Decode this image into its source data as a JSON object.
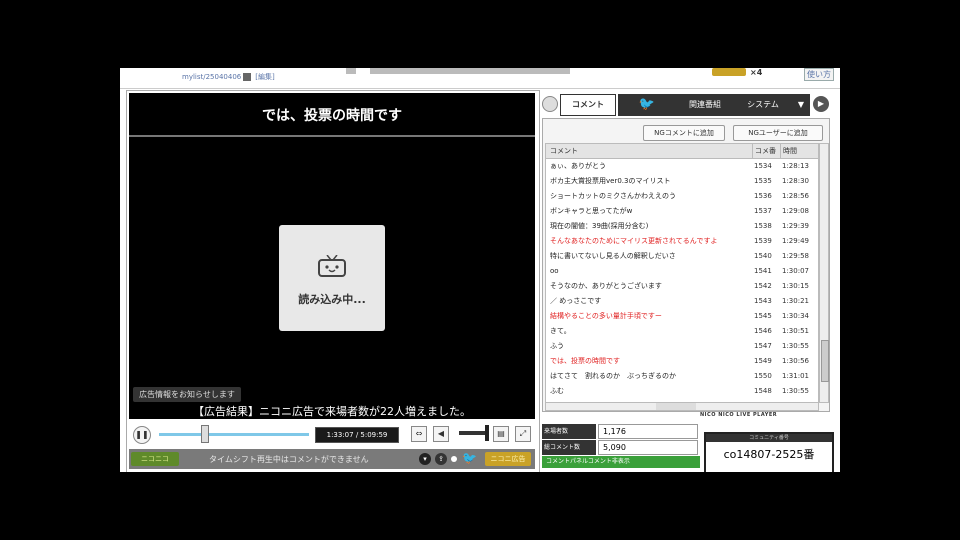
{
  "top": {
    "mylist": "mylist/25040406",
    "edit": "[編集]",
    "coin_count": "×4",
    "howto": "使い方"
  },
  "player": {
    "title": "では、投票の時間です",
    "loading": "読み込み中...",
    "ad_notice": "広告情報をお知らせします",
    "ad_result_prefix": "【広告結果】ニコニ広告で来場者数が",
    "ad_result_num": "22",
    "ad_result_suffix": "人増えました。",
    "time": "1:33:07 / 5:09:59",
    "logo_left": "ニコニコ",
    "timeshift_notice": "タイムシフト再生中はコメントができません",
    "logo_right": "ニコニ広告",
    "seek_progress": 0.3
  },
  "tabs": {
    "comment": "コメント",
    "twitter": "twitter-icon",
    "related": "関連番組",
    "system": "システム",
    "arrow": "▼"
  },
  "comments": {
    "ng_comment": "NGコメントに追加",
    "ng_user": "NGユーザーに追加",
    "col_comment": "コメント",
    "col_no": "コメ番",
    "col_time": "時間",
    "rows": [
      {
        "c": "ぁぃ、ありがとう",
        "n": "1534",
        "t": "1:28:13",
        "red": false
      },
      {
        "c": "ボカ主大賞投票用ver0.3のマイリスト",
        "n": "1535",
        "t": "1:28:30",
        "red": false
      },
      {
        "c": "ショートカットのミクさんかわええのう",
        "n": "1536",
        "t": "1:28:56",
        "red": false
      },
      {
        "c": "ボンキャラと思ってたがw",
        "n": "1537",
        "t": "1:29:08",
        "red": false
      },
      {
        "c": "現在の闇値：39曲(採用分含む)",
        "n": "1538",
        "t": "1:29:39",
        "red": false
      },
      {
        "c": "そんなあなたのためにマイリス更新されてるんですよ",
        "n": "1539",
        "t": "1:29:49",
        "red": true
      },
      {
        "c": "特に書いてないし見る人の解釈しだいさ",
        "n": "1540",
        "t": "1:29:58",
        "red": false
      },
      {
        "c": "oo",
        "n": "1541",
        "t": "1:30:07",
        "red": false
      },
      {
        "c": "そうなのか、ありがとうございます",
        "n": "1542",
        "t": "1:30:15",
        "red": false
      },
      {
        "c": "／ めっさこです",
        "n": "1543",
        "t": "1:30:21",
        "red": false
      },
      {
        "c": "結構やることの多い量計手頃ですー",
        "n": "1545",
        "t": "1:30:34",
        "red": true
      },
      {
        "c": "きて。",
        "n": "1546",
        "t": "1:30:51",
        "red": false
      },
      {
        "c": "ふう",
        "n": "1547",
        "t": "1:30:55",
        "red": false
      },
      {
        "c": "では、投票の時間です",
        "n": "1549",
        "t": "1:30:56",
        "red": true
      },
      {
        "c": "はてさて　割れるのか　ぶっちぎるのか",
        "n": "1550",
        "t": "1:31:01",
        "red": false
      },
      {
        "c": "ふむ",
        "n": "1548",
        "t": "1:30:55",
        "red": false
      }
    ]
  },
  "brand": "NICO NICO LIVE PLAYER",
  "stats": {
    "visitors_label": "来場者数",
    "visitors": "1,176",
    "comments_label": "総コメント数",
    "comments": "5,090",
    "green": "コメントパネルコメント非表示"
  },
  "community": {
    "bar": "コミュニティ番号",
    "id": "co14807-2525番"
  },
  "colors": {
    "red_comment": "#e02020",
    "twitter": "#4aaee8",
    "seek": "#7fc8e8"
  }
}
